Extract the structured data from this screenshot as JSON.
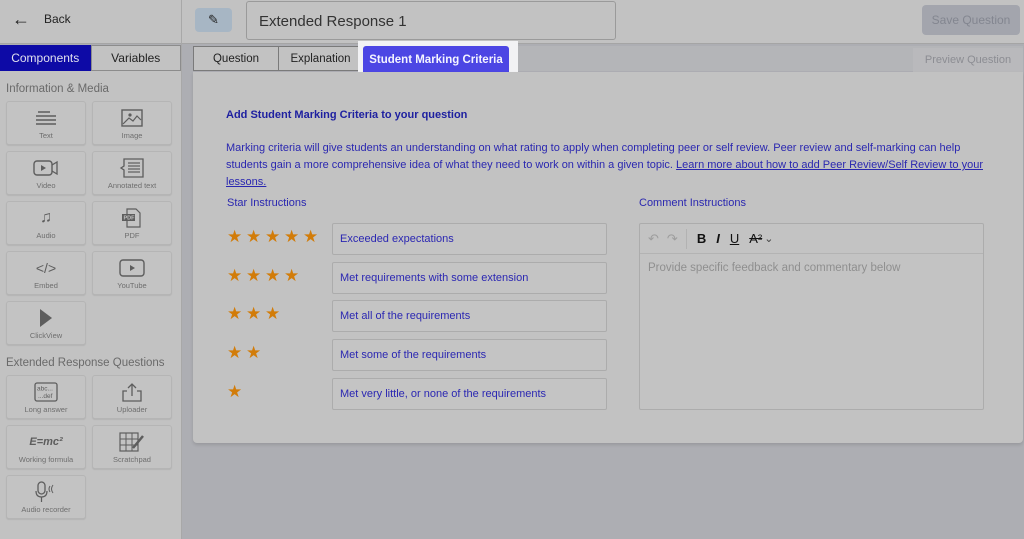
{
  "header": {
    "back_label": "Back",
    "back_icon": "arrow-left-icon",
    "edit_icon": "pencil-icon",
    "title_value": "Extended Response 1",
    "save_label": "Save Question"
  },
  "sidebar": {
    "tabs": [
      {
        "label": "Components",
        "active": true
      },
      {
        "label": "Variables",
        "active": false
      }
    ],
    "sections": [
      {
        "title": "Information & Media",
        "items": [
          {
            "label": "Text",
            "icon": "text-lines-icon"
          },
          {
            "label": "Image",
            "icon": "image-icon"
          },
          {
            "label": "Video",
            "icon": "video-camera-icon"
          },
          {
            "label": "Annotated text",
            "icon": "annotated-text-icon"
          },
          {
            "label": "Audio",
            "icon": "music-note-icon"
          },
          {
            "label": "PDF",
            "icon": "pdf-file-icon"
          },
          {
            "label": "Embed",
            "icon": "code-brackets-icon"
          },
          {
            "label": "YouTube",
            "icon": "youtube-play-icon"
          },
          {
            "label": "ClickView",
            "icon": "play-triangle-icon"
          }
        ]
      },
      {
        "title": "Extended Response Questions",
        "items": [
          {
            "label": "Long answer",
            "icon": "long-answer-icon",
            "glyph": "abc...\n...def"
          },
          {
            "label": "Uploader",
            "icon": "upload-icon"
          },
          {
            "label": "Working formula",
            "icon": "formula-icon",
            "glyph": "E=mc²"
          },
          {
            "label": "Scratchpad",
            "icon": "scratchpad-grid-icon"
          },
          {
            "label": "Audio recorder",
            "icon": "microphone-icon"
          }
        ]
      }
    ]
  },
  "main": {
    "tabs": [
      {
        "label": "Question",
        "active": false
      },
      {
        "label": "Explanation",
        "active": false
      },
      {
        "label": "Student Marking Criteria",
        "active": true
      }
    ],
    "preview_label": "Preview Question",
    "title": "Add Student Marking Criteria to your question",
    "description": "Marking criteria will give students an understanding on what rating to apply when completing peer or self review. Peer review and self-marking can help students gain a more comprehensive idea of what they need to work on within a given topic.",
    "link_text": "Learn more about how to add Peer Review/Self Review to your lessons.",
    "star_label": "Star Instructions",
    "comment_label": "Comment Instructions",
    "criteria": [
      {
        "stars": 5,
        "text": "Exceeded expectations"
      },
      {
        "stars": 4,
        "text": "Met requirements with some extension"
      },
      {
        "stars": 3,
        "text": "Met all of the requirements"
      },
      {
        "stars": 2,
        "text": "Met some of the requirements"
      },
      {
        "stars": 1,
        "text": "Met very little, or none of the requirements"
      }
    ],
    "editor": {
      "toolbar": [
        {
          "name": "undo-icon",
          "glyph": "↶",
          "enabled": false
        },
        {
          "name": "redo-icon",
          "glyph": "↷",
          "enabled": false
        },
        {
          "name": "bold-icon",
          "glyph": "B",
          "enabled": true
        },
        {
          "name": "italic-icon",
          "glyph": "I",
          "enabled": true
        },
        {
          "name": "underline-icon",
          "glyph": "U",
          "enabled": true
        },
        {
          "name": "superscript-icon",
          "glyph": "A²",
          "enabled": true
        },
        {
          "name": "chevron-down-icon",
          "glyph": "⌄",
          "enabled": true
        }
      ],
      "placeholder": "Provide specific feedback and commentary below"
    }
  },
  "colors": {
    "accent_tab": "#4c46e4",
    "sidebar_tab_active": "#0d0aa6",
    "star": "#d27c09",
    "text_blue": "#2a27b0"
  }
}
